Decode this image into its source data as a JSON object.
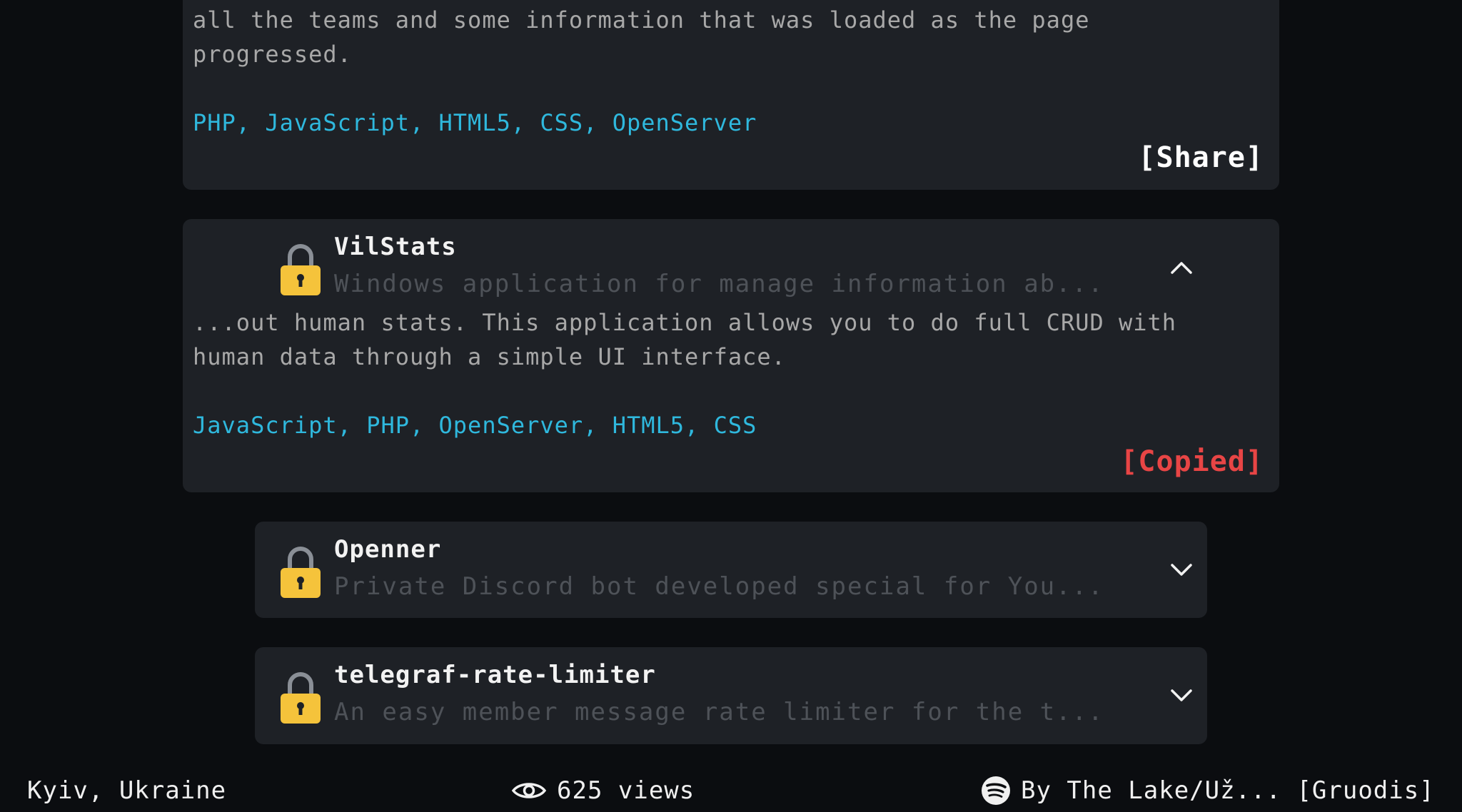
{
  "projects": {
    "top": {
      "description": "all the teams and some information that was loaded as the page\nprogressed.",
      "tags": [
        "PHP",
        "JavaScript",
        "HTML5",
        "CSS",
        "OpenServer"
      ],
      "action_label": "[Share]"
    },
    "vilstats": {
      "title": "VilStats",
      "subtitle": "Windows application for manage information ab...",
      "description": "...out human stats. This application allows you to do full CRUD with\nhuman data through a simple UI interface.",
      "tags": [
        "JavaScript",
        "PHP",
        "OpenServer",
        "HTML5",
        "CSS"
      ],
      "action_label": "[Copied]",
      "icon": "lock-icon",
      "toggle_icon": "chevron-up-icon"
    },
    "openner": {
      "title": "Openner",
      "subtitle": "Private Discord bot developed special for You...",
      "icon": "lock-icon",
      "toggle_icon": "chevron-down-icon"
    },
    "telegraf": {
      "title": "telegraf-rate-limiter",
      "subtitle": "An easy member message rate limiter for the t...",
      "icon": "lock-icon",
      "toggle_icon": "chevron-down-icon"
    }
  },
  "footer": {
    "location": "Kyiv, Ukraine",
    "views": "625 views",
    "now_playing": "By The Lake/Už... [Gruodis]"
  },
  "colors": {
    "background": "#0b0d10",
    "card": "#1e2126",
    "tag": "#2fb8dd",
    "copied": "#e84545",
    "lock": "#f5c33b"
  }
}
